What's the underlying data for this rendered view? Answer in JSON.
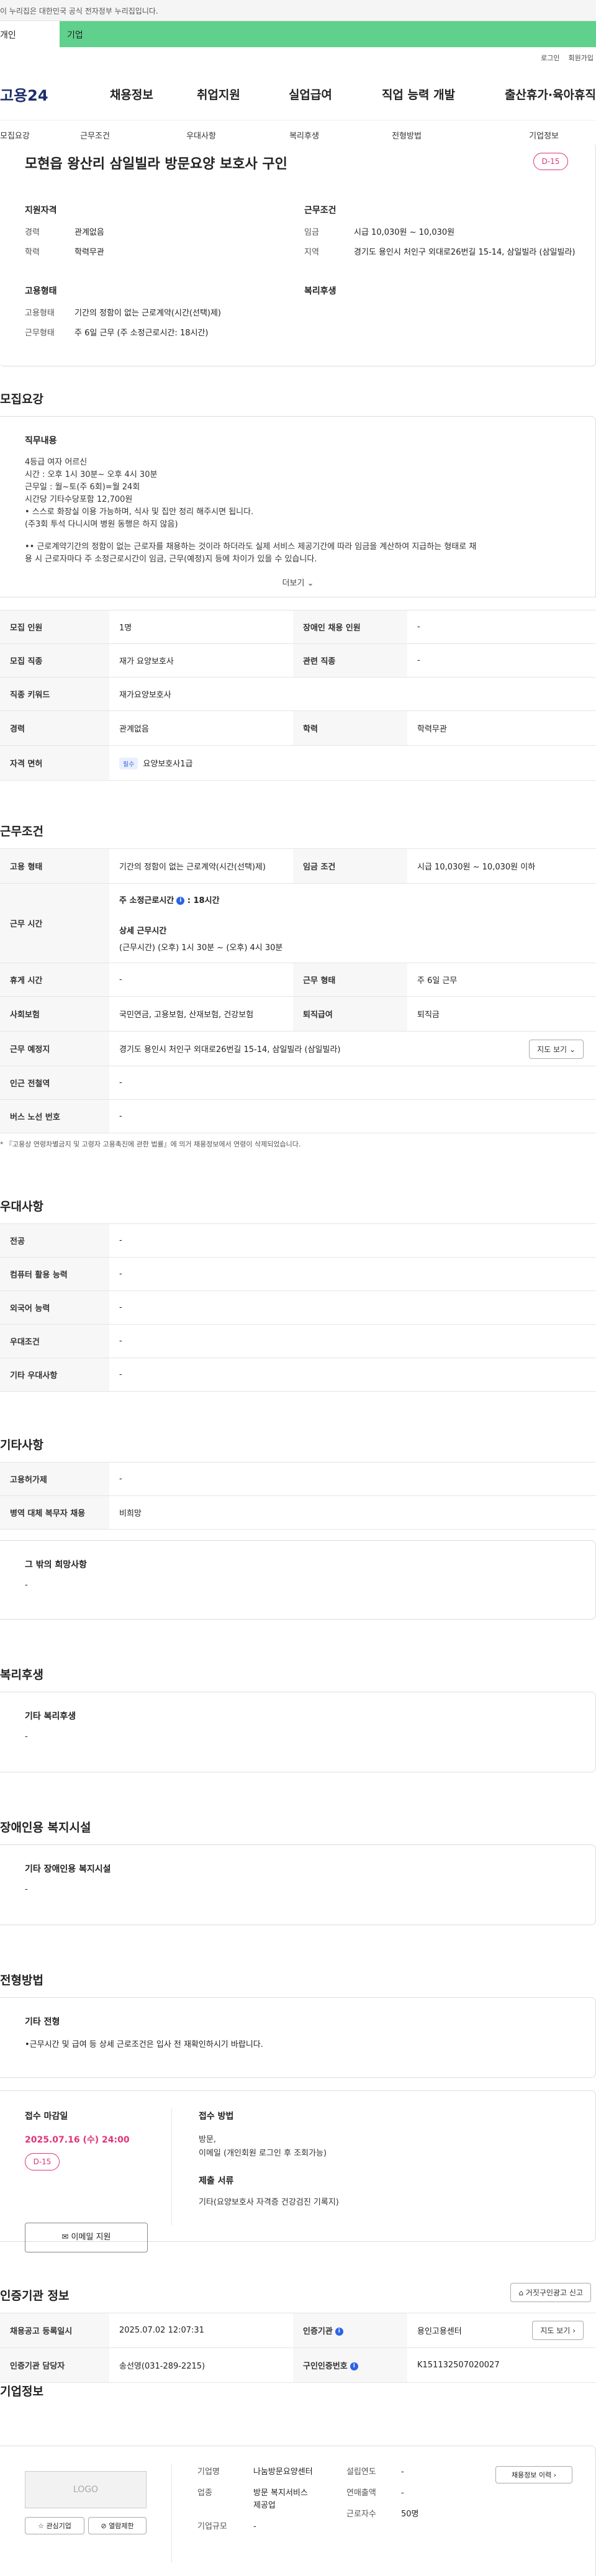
{
  "banner": {
    "text": "이 누리집은 대한민국 공식 전자정부 누리집입니다."
  },
  "tabs": {
    "person": "개인",
    "company": "기업"
  },
  "toplinks": {
    "login": "로그인",
    "signup": "회원가입"
  },
  "header": {
    "logo": "고용24",
    "menu": [
      "채용정보",
      "취업지원",
      "실업급여",
      "직업 능력 개발",
      "출산휴가·육아휴직"
    ]
  },
  "subnav": [
    "모집요강",
    "근무조건",
    "우대사항",
    "복리후생",
    "전형방법",
    "기업정보"
  ],
  "job": {
    "title": "모현읍 왕산리 삼일빌라 방문요양 보호사 구인",
    "dday": "D-15",
    "qual_title": "지원자격",
    "qual": [
      {
        "k": "경력",
        "v": "관계없음"
      },
      {
        "k": "학력",
        "v": "학력무관"
      }
    ],
    "cond_title": "근무조건",
    "cond": [
      {
        "k": "임금",
        "v": "시급 10,030원 ~ 10,030원"
      },
      {
        "k": "지역",
        "v": "경기도 용인시 처인구 외대로26번길 15-14, 삼일빌라 (삼일빌라)"
      }
    ],
    "form_title": "고용형태",
    "form": [
      {
        "k": "고용형태",
        "v": "기간의 정함이 없는 근로계약(시간(선택)제)"
      },
      {
        "k": "근무형태",
        "v": "주 6일 근무 (주 소정근로시간: 18시간)"
      }
    ],
    "welfare_title": "복리후생"
  },
  "recruit": {
    "title": "모집요강",
    "duty_title": "직무내용",
    "duty_lines": [
      "4등급 여자 어르신",
      "시간 : 오후 1시 30분~ 오후 4시 30분",
      "근무일 : 월~토(주 6회)=월 24회",
      "시간당 기타수당포함  12,700원",
      "• 스스로 화장실 이용 가능하며, 식사 및 집안 정리 해주시면 됩니다.",
      "(주3회 투석 다니시며 병원 동행은 하지 않음)",
      "",
      "•• 근로계약기간의 정함이 없는 근로자를 채용하는 것이라 하더라도 실제 서비스 제공기간에 따라 임금을 계산하여 지급하는 형태로 채",
      "용 시 근로자마다 주 소정근로시간이 임금, 근무(예정)지 등에 차이가 있을 수 있습니다."
    ],
    "more": "더보기",
    "table": [
      [
        {
          "h": "모집 인원"
        },
        {
          "v": "1명"
        },
        {
          "h": "장애인 채용 인원"
        },
        {
          "v": "-"
        }
      ],
      [
        {
          "h": "모집 직종"
        },
        {
          "v": "재가 요양보호사"
        },
        {
          "h": "관련 직종"
        },
        {
          "v": "-"
        }
      ],
      [
        {
          "h": "직종 키워드"
        },
        {
          "v": "재가요양보호사"
        }
      ],
      [
        {
          "h": "경력"
        },
        {
          "v": "관계없음"
        },
        {
          "h": "학력"
        },
        {
          "v": "학력무관"
        }
      ],
      [
        {
          "h": "자격 면허"
        },
        {
          "badge": "필수",
          "v": "요양보호사1급"
        }
      ]
    ]
  },
  "conditions": {
    "title": "근무조건",
    "employ_h": "고용 형태",
    "employ_v": "기간의 정함이 없는 근로계약(시간(선택)제)",
    "wage_h": "임금 조건",
    "wage_v": "시급 10,030원 ~ 10,030원 이하",
    "hours_h": "근무 시간",
    "hours_weekly": "주 소정근로시간",
    "hours_weekly_value": "18시간",
    "hours_detail_title": "상세 근무시간",
    "hours_detail": "(근무시간) (오후) 1시 30분 ~ (오후) 4시 30분",
    "rest_h": "휴게 시간",
    "rest_v": "-",
    "workform_h": "근무 형태",
    "workform_v": "주 6일 근무",
    "insurance_h": "사회보험",
    "insurance_v": "국민연금, 고용보험, 산재보험, 건강보험",
    "severance_h": "퇴직급여",
    "severance_v": "퇴직금",
    "place_h": "근무 예정지",
    "place_v": "경기도 용인시 처인구 외대로26번길 15-14, 삼일빌라 (삼일빌라)",
    "map_btn": "지도 보기",
    "subway_h": "인근 전철역",
    "subway_v": "-",
    "bus_h": "버스 노선 번호",
    "bus_v": "-",
    "note": "* 『고용상 연령차별금지 및 고령자 고용촉진에 관한 법률』에 의거 채용정보에서 연령이 삭제되었습니다."
  },
  "prefer": {
    "title": "우대사항",
    "rows": [
      {
        "h": "전공",
        "v": "-"
      },
      {
        "h": "컴퓨터 활용 능력",
        "v": "-"
      },
      {
        "h": "외국어 능력",
        "v": "-"
      },
      {
        "h": "우대조건",
        "v": "-"
      },
      {
        "h": "기타 우대사항",
        "v": "-"
      }
    ]
  },
  "etc": {
    "title": "기타사항",
    "rows": [
      {
        "h": "고용허가제",
        "v": "-"
      },
      {
        "h": "병역 대체 복무자 채용",
        "v": "비희망"
      }
    ],
    "wish_title": "그 밖의 희망사항",
    "wish_value": "-"
  },
  "welfare": {
    "title": "복리후생",
    "box_title": "기타 복리후생",
    "box_value": "-"
  },
  "disability": {
    "title": "장애인용 복지시설",
    "box_title": "기타 장애인용 복지시설",
    "box_value": "-"
  },
  "selection": {
    "title": "전형방법",
    "box_title": "기타 전형",
    "box_value": "•근무시간 및 급여 등 상세 근로조건은 입사 전 재확인하시기 바랍니다.",
    "deadline_title": "접수 마감일",
    "deadline": "2025.07.16 (수) 24:00",
    "dday": "D-15",
    "method_title": "접수 방법",
    "methods": [
      "방문,",
      "이메일 (개인회원 로그인 후 조회가능)"
    ],
    "docs_title": "제출 서류",
    "docs": "기타(요양보호사 자격증 건강검진 기록지)",
    "apply_btn": "이메일 지원"
  },
  "auth": {
    "title": "인증기관 정보",
    "report_btn": "거짓구인광고 신고",
    "reg_date_h": "채용공고 등록일시",
    "reg_date_v": "2025.07.02 12:07:31",
    "agency_h": "인증기관",
    "agency_v": "용인고용센터",
    "map_btn": "지도 보기",
    "manager_h": "인증기관 담당자",
    "manager_v": "송선영(031-289-2215)",
    "auth_no_h": "구인인증번호",
    "auth_no_v": "K151132507020027"
  },
  "company": {
    "title": "기업정보",
    "logo": "LOGO",
    "interest_btn": "관심기업",
    "block_btn": "열람제한",
    "name_h": "기업명",
    "name_v": "나눔방문요양센터",
    "industry_h": "업종",
    "industry_v1": "방문 복지서비스",
    "industry_v2": "제공업",
    "scale_h": "기업규모",
    "scale_v": "-",
    "founded_h": "설립연도",
    "founded_v": "-",
    "sales_h": "연매출액",
    "sales_v": "-",
    "employees_h": "근로자수",
    "employees_v": "50명",
    "jobs_btn": "채용정보 이력"
  }
}
